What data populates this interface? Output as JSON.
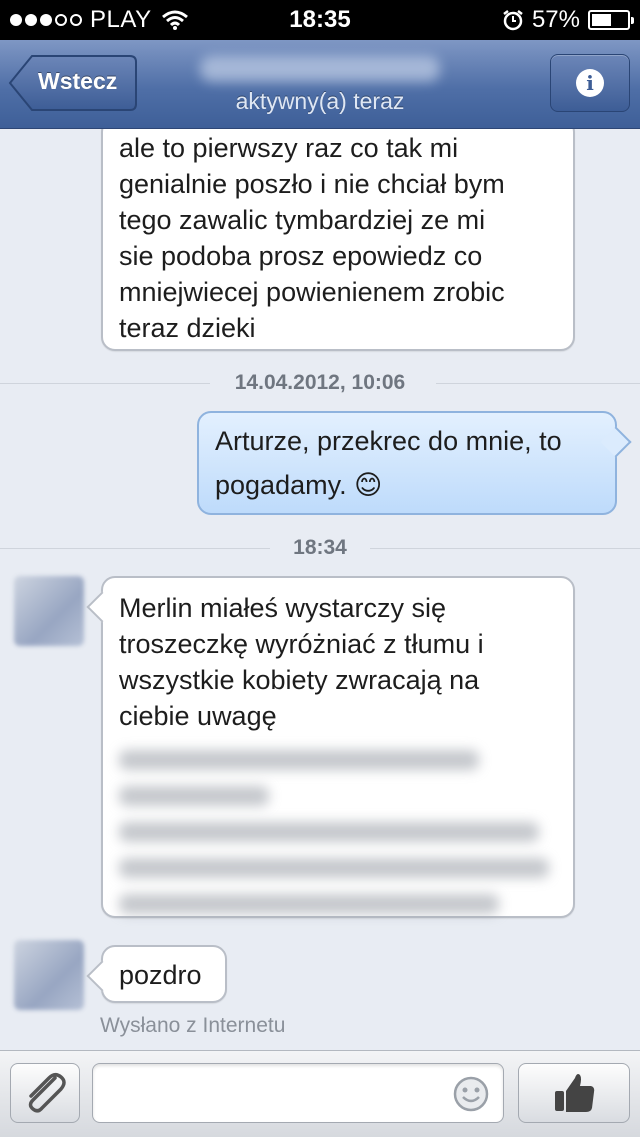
{
  "status_bar": {
    "carrier": "PLAY",
    "time": "18:35",
    "battery_percent": "57%",
    "battery_level": 0.57,
    "signal_bars_filled": 3,
    "signal_bars_total": 5
  },
  "nav": {
    "back_label": "Wstecz",
    "subtitle": "aktywny(a) teraz",
    "info_icon": "info-icon"
  },
  "messages": {
    "first": {
      "lines": [
        "ale to pierwszy raz co tak mi",
        "genialnie poszło i nie chciał bym",
        "tego zawalic tymbardziej ze mi",
        "sie podoba prosz epowiedz co",
        "mniejwiecej powienienem  zrobic",
        "teraz  dzieki"
      ]
    },
    "ts1": "14.04.2012, 10:06",
    "outgoing": {
      "line1": "Arturze, przekrec do mnie, to",
      "line2": "pogadamy.",
      "emoji": "😊"
    },
    "ts2": "18:34",
    "incoming": {
      "lines": [
        "Merlin miałeś wystarczy się",
        "troszeczkę wyróżniać z tłumu i",
        "wszystkie kobiety zwracają na",
        "ciebie uwagę"
      ]
    },
    "short": "pozdro",
    "sent_via": "Wysłano z Internetu"
  },
  "input_bar": {
    "attach_icon": "paperclip-icon",
    "emoji_icon": "smiley-icon",
    "like_icon": "thumbs-up-icon",
    "value": ""
  },
  "colors": {
    "nav_top": "#7f97c4",
    "nav_bottom": "#3e5f98",
    "chat_bg": "#e8ecf3",
    "outgoing_bubble": "#bedbfb"
  }
}
